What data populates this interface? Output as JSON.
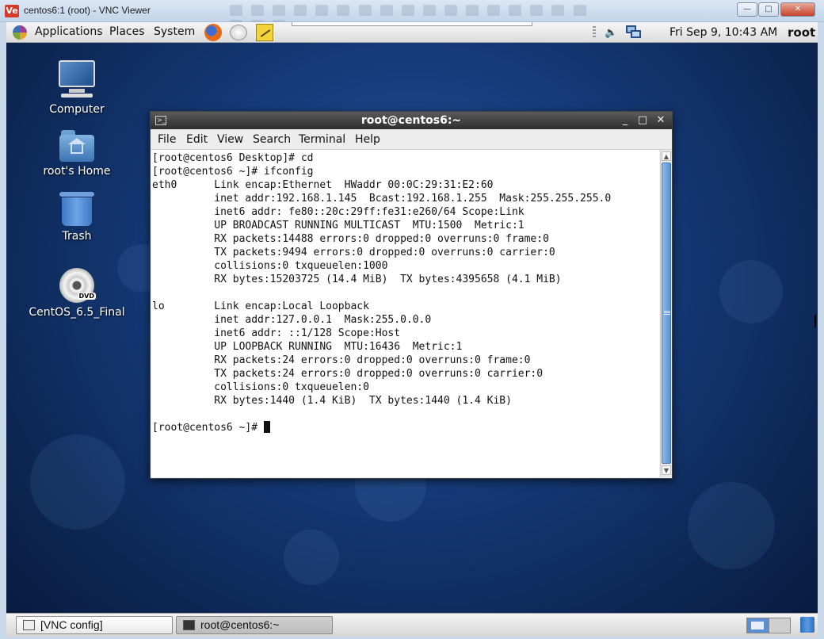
{
  "vnc_window": {
    "app_icon": "Ve",
    "title": "centos6:1 (root) - VNC Viewer",
    "minimize_glyph": "—",
    "maximize_glyph": "□",
    "close_glyph": "✕"
  },
  "panel": {
    "menus": {
      "applications": "Applications",
      "places": "Places",
      "system": "System"
    },
    "volume_glyph": "🔈",
    "clock": "Fri Sep  9, 10:43 AM",
    "user": "root"
  },
  "desktop_icons": [
    {
      "label": "Computer",
      "icon": "computer-icon"
    },
    {
      "label": "root's Home",
      "icon": "home-folder-icon"
    },
    {
      "label": "Trash",
      "icon": "trash-icon"
    },
    {
      "label": "CentOS_6.5_Final",
      "icon": "dvd-icon",
      "badge": "DVD"
    }
  ],
  "terminal": {
    "title": "root@centos6:~",
    "title_icon": ">_",
    "controls": {
      "minimize": "_",
      "maximize": "□",
      "close": "✕"
    },
    "menu": [
      "File",
      "Edit",
      "View",
      "Search",
      "Terminal",
      "Help"
    ],
    "lines": [
      "[root@centos6 Desktop]# cd",
      "[root@centos6 ~]# ifconfig",
      "eth0      Link encap:Ethernet  HWaddr 00:0C:29:31:E2:60  ",
      "          inet addr:192.168.1.145  Bcast:192.168.1.255  Mask:255.255.255.0",
      "          inet6 addr: fe80::20c:29ff:fe31:e260/64 Scope:Link",
      "          UP BROADCAST RUNNING MULTICAST  MTU:1500  Metric:1",
      "          RX packets:14488 errors:0 dropped:0 overruns:0 frame:0",
      "          TX packets:9494 errors:0 dropped:0 overruns:0 carrier:0",
      "          collisions:0 txqueuelen:1000 ",
      "          RX bytes:15203725 (14.4 MiB)  TX bytes:4395658 (4.1 MiB)",
      "",
      "lo        Link encap:Local Loopback  ",
      "          inet addr:127.0.0.1  Mask:255.0.0.0",
      "          inet6 addr: ::1/128 Scope:Host",
      "          UP LOOPBACK RUNNING  MTU:16436  Metric:1",
      "          RX packets:24 errors:0 dropped:0 overruns:0 frame:0",
      "          TX packets:24 errors:0 dropped:0 overruns:0 carrier:0",
      "          collisions:0 txqueuelen:0 ",
      "          RX bytes:1440 (1.4 KiB)  TX bytes:1440 (1.4 KiB)",
      ""
    ],
    "prompt": "[root@centos6 ~]# ",
    "scroll_up_glyph": "▲",
    "scroll_down_glyph": "▼"
  },
  "taskbar": {
    "items": [
      {
        "label": "[VNC config]",
        "active": false
      },
      {
        "label": "root@centos6:~",
        "active": true
      }
    ]
  },
  "colors": {
    "desktop_bg": "#173e7f",
    "terminal_titlebar": "#2e2e2e",
    "scrollbar_thumb": "#5d92d2"
  }
}
